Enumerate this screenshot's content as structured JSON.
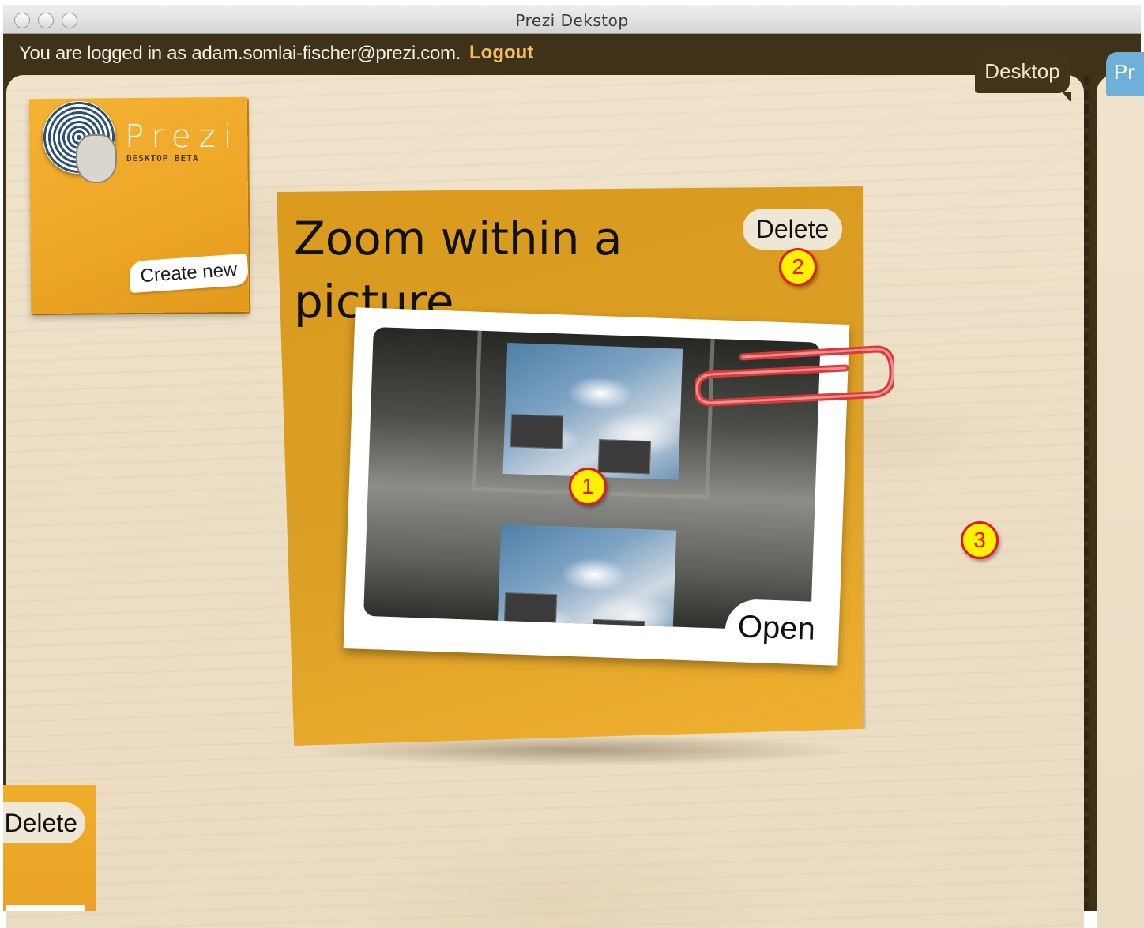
{
  "window": {
    "title": "Prezi Dekstop"
  },
  "account": {
    "status_text": "You are logged in as adam.somlai-fischer@prezi.com.",
    "logout_label": "Logout"
  },
  "tabs": [
    {
      "label": "Desktop"
    },
    {
      "label": "Pr"
    }
  ],
  "logo": {
    "word": "Prezi",
    "subtitle": "DESKTOP BETA",
    "create_label": "Create new"
  },
  "prezi_card": {
    "title": "Zoom within a picture",
    "delete_label": "Delete",
    "open_label": "Open"
  },
  "partial_card": {
    "delete_label": "Delete"
  },
  "callouts": [
    "1",
    "2",
    "3"
  ],
  "colors": {
    "titlebar": "#d9d9d9",
    "toolbar": "#3e3318",
    "board": "#ecdfc6",
    "note": "#dca026",
    "logout": "#f0c060",
    "tab_desktop": "#40341a",
    "tab_prezi": "#6fb0d8",
    "callout_fill": "#fff200",
    "callout_border": "#e21a1a"
  }
}
